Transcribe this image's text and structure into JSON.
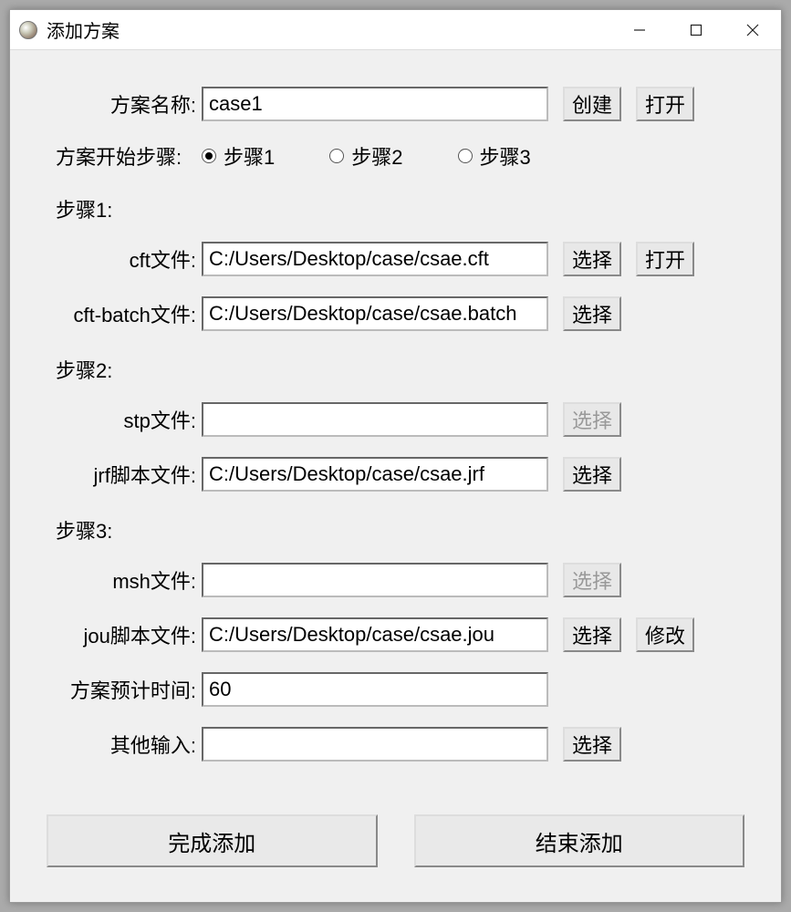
{
  "window": {
    "title": "添加方案"
  },
  "scheme_name": {
    "label": "方案名称:",
    "value": "case1",
    "create_btn": "创建",
    "open_btn": "打开"
  },
  "start_step": {
    "label": "方案开始步骤:",
    "options": [
      "步骤1",
      "步骤2",
      "步骤3"
    ],
    "selected": 0
  },
  "step1": {
    "title": "步骤1:",
    "cft": {
      "label": "cft文件:",
      "value": "C:/Users/Desktop/case/csae.cft",
      "select_btn": "选择",
      "open_btn": "打开"
    },
    "cft_batch": {
      "label": "cft-batch文件:",
      "value": "C:/Users/Desktop/case/csae.batch",
      "select_btn": "选择"
    }
  },
  "step2": {
    "title": "步骤2:",
    "stp": {
      "label": "stp文件:",
      "value": "",
      "select_btn": "选择",
      "disabled": true
    },
    "jrf": {
      "label": "jrf脚本文件:",
      "value": "C:/Users/Desktop/case/csae.jrf",
      "select_btn": "选择"
    }
  },
  "step3": {
    "title": "步骤3:",
    "msh": {
      "label": "msh文件:",
      "value": "",
      "select_btn": "选择",
      "disabled": true
    },
    "jou": {
      "label": "jou脚本文件:",
      "value": "C:/Users/Desktop/case/csae.jou",
      "select_btn": "选择",
      "modify_btn": "修改"
    }
  },
  "est_time": {
    "label": "方案预计时间:",
    "value": "60"
  },
  "other_input": {
    "label": "其他输入:",
    "value": "",
    "select_btn": "选择"
  },
  "footer": {
    "finish": "完成添加",
    "end": "结束添加"
  }
}
